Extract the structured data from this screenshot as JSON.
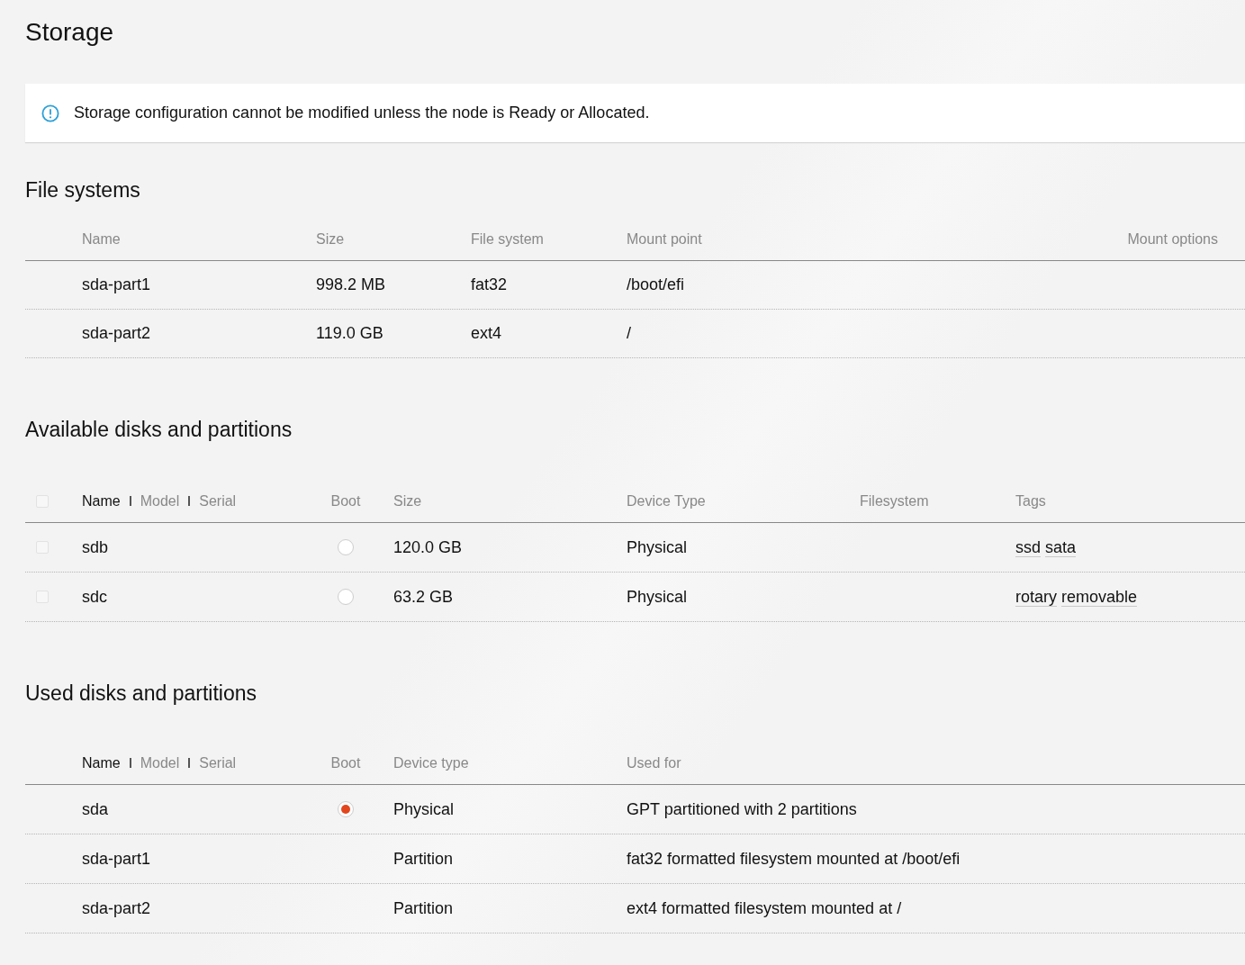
{
  "page_title": "Storage",
  "notification": {
    "kind": "information",
    "message": "Storage configuration cannot be modified unless the node is Ready or Allocated."
  },
  "file_systems": {
    "heading": "File systems",
    "columns": [
      "Name",
      "Size",
      "File system",
      "Mount point",
      "Mount options"
    ],
    "rows": [
      {
        "name": "sda-part1",
        "size": "998.2 MB",
        "file_system": "fat32",
        "mount_point": "/boot/efi"
      },
      {
        "name": "sda-part2",
        "size": "119.0 GB",
        "file_system": "ext4",
        "mount_point": "/"
      }
    ]
  },
  "available_disks": {
    "heading": "Available disks and partitions",
    "select_all": {
      "checked": false
    },
    "sort_fields": [
      {
        "label": "Name",
        "selected": true
      },
      {
        "label": "Model",
        "selected": false
      },
      {
        "label": "Serial",
        "selected": false
      }
    ],
    "columns": [
      "Boot",
      "Size",
      "Device Type",
      "Filesystem",
      "Tags"
    ],
    "rows": [
      {
        "checked": false,
        "name": "sdb",
        "boot": {
          "selected": false
        },
        "size": "120.0 GB",
        "device_type": "Physical",
        "tags": [
          "ssd",
          "sata"
        ]
      },
      {
        "checked": false,
        "name": "sdc",
        "boot": {
          "selected": false
        },
        "size": "63.2 GB",
        "device_type": "Physical",
        "tags": [
          "rotary",
          "removable"
        ]
      }
    ]
  },
  "used_disks": {
    "heading": "Used disks and partitions",
    "sort_fields": [
      {
        "label": "Name",
        "selected": true
      },
      {
        "label": "Model",
        "selected": false
      },
      {
        "label": "Serial",
        "selected": false
      }
    ],
    "columns": [
      "Boot",
      "Device type",
      "Used for"
    ],
    "rows": [
      {
        "name": "sda",
        "boot": {
          "selected": true
        },
        "device_type": "Physical",
        "used_for": "GPT partitioned with 2 partitions"
      },
      {
        "name": "sda-part1",
        "device_type": "Partition",
        "used_for": "fat32 formatted filesystem mounted at /boot/efi"
      },
      {
        "name": "sda-part2",
        "device_type": "Partition",
        "used_for": "ext4 formatted filesystem mounted at /"
      }
    ]
  }
}
